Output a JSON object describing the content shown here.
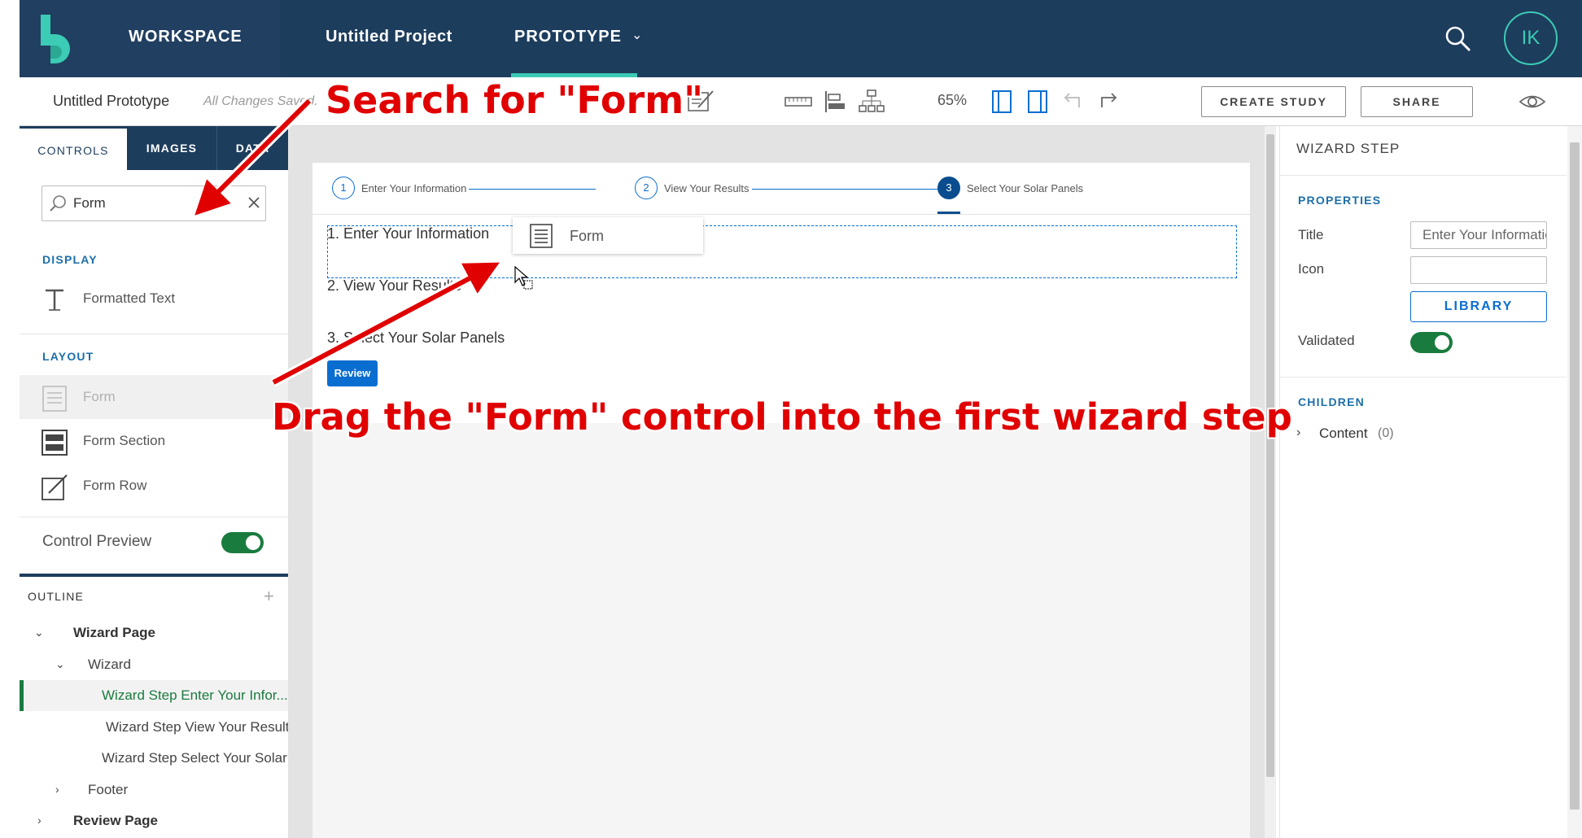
{
  "header": {
    "workspace_label": "WORKSPACE",
    "project_label": "Untitled Project",
    "prototype_label": "PROTOTYPE",
    "avatar_initials": "IK",
    "accent_color": "#3ccbb4",
    "bg_color": "#1d3d5d"
  },
  "toolbar": {
    "title": "Untitled Prototype",
    "saved_status": "All Changes Saved.",
    "zoom": "65%",
    "create_study_label": "CREATE STUDY",
    "share_label": "SHARE"
  },
  "left_panel": {
    "tabs": [
      "CONTROLS",
      "IMAGES",
      "DATA"
    ],
    "search": {
      "value": "Form",
      "placeholder": ""
    },
    "display_label": "DISPLAY",
    "display_items": [
      "Formatted Text"
    ],
    "layout_label": "LAYOUT",
    "layout_items": [
      "Form",
      "Form Section",
      "Form Row"
    ],
    "control_preview_label": "Control Preview",
    "control_preview_on": true
  },
  "outline": {
    "title": "OUTLINE",
    "items": [
      {
        "label": "Wizard Page"
      },
      {
        "label": "Wizard"
      },
      {
        "label": "Wizard Step Enter Your Infor..."
      },
      {
        "label": "Wizard Step View Your Results"
      },
      {
        "label": "Wizard Step Select Your Solar ..."
      },
      {
        "label": "Footer"
      },
      {
        "label": "Review Page"
      }
    ]
  },
  "canvas": {
    "steps": [
      {
        "num": "1",
        "label": "Enter Your Information"
      },
      {
        "num": "2",
        "label": "View Your Results"
      },
      {
        "num": "3",
        "label": "Select Your Solar Panels"
      }
    ],
    "content_lines": [
      "1. Enter Your Information",
      "2. View Your Results",
      "3. Select Your Solar Panels"
    ],
    "review_button": "Review",
    "drag_ghost_label": "Form"
  },
  "right_panel": {
    "title": "WIZARD STEP",
    "properties_label": "PROPERTIES",
    "title_label": "Title",
    "title_value": "Enter Your Information",
    "icon_label": "Icon",
    "icon_value": "",
    "library_label": "LIBRARY",
    "validated_label": "Validated",
    "validated_on": true,
    "children_label": "CHILDREN",
    "content_label": "Content",
    "content_count": "(0)"
  },
  "annotations": {
    "search_hint": "Search for \"Form\"",
    "drag_hint": "Drag the \"Form\" control into the first wizard step",
    "color": "#e00000"
  }
}
